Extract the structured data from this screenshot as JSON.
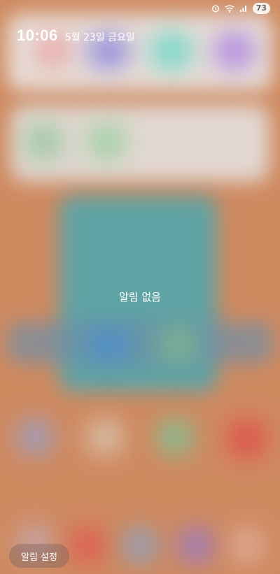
{
  "status_bar": {
    "icons": [
      "alarm-icon",
      "wifi-icon",
      "signal-icon"
    ],
    "battery": "73"
  },
  "header": {
    "time": "10:06",
    "date": "5월 23일 금요일"
  },
  "notifications": {
    "empty_text": "알림 없음"
  },
  "footer": {
    "settings_label": "알림 설정"
  }
}
